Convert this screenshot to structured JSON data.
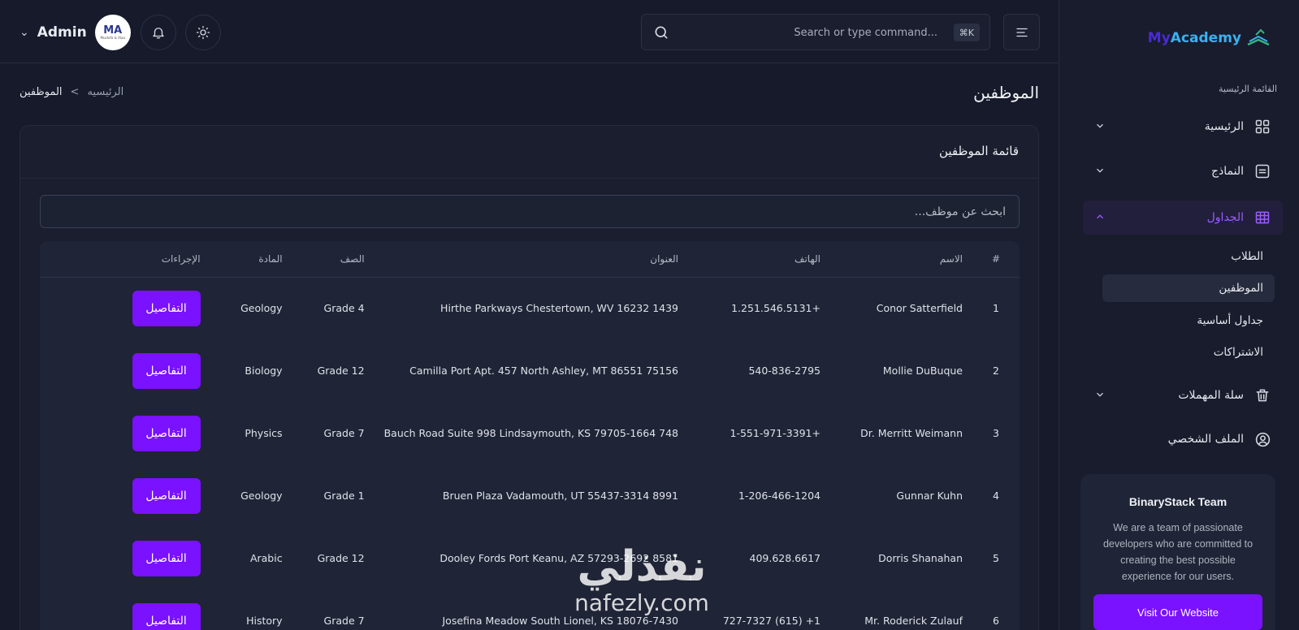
{
  "header": {
    "user_name": "Admin",
    "avatar_initials": "MA",
    "avatar_subtext": "Mustafa & Alaa",
    "search_placeholder": "Search or type command...",
    "search_shortcut": "⌘K"
  },
  "page": {
    "title": "الموظفين",
    "breadcrumb": {
      "current": "الموظفين",
      "separator": "<",
      "home": "الرئيسيه"
    }
  },
  "card": {
    "title": "قائمة الموظفين",
    "search_placeholder": "ابحث عن موظف..."
  },
  "table": {
    "headers": {
      "index": "#",
      "name": "الاسم",
      "phone": "الهاتف",
      "address": "العنوان",
      "grade": "الصف",
      "subject": "المادة",
      "actions": "الإجراءات"
    },
    "details_label": "التفاصيل",
    "rows": [
      {
        "index": "1",
        "name": "Conor Satterfield",
        "phone": "+1.251.546.5131",
        "address": "1439 Hirthe Parkways Chestertown, WV 16232",
        "grade": "Grade 4",
        "subject": "Geology"
      },
      {
        "index": "2",
        "name": "Mollie DuBuque",
        "phone": "540-836-2795",
        "address": "75156 Camilla Port Apt. 457 North Ashley, MT 86551",
        "grade": "Grade 12",
        "subject": "Biology"
      },
      {
        "index": "3",
        "name": "Dr. Merritt Weimann",
        "phone": "+1-551-971-3391",
        "address": "748 Bauch Road Suite 998 Lindsaymouth, KS 79705-1664",
        "grade": "Grade 7",
        "subject": "Physics"
      },
      {
        "index": "4",
        "name": "Gunnar Kuhn",
        "phone": "1-206-466-1204",
        "address": "8991 Bruen Plaza Vadamouth, UT 55437-3314",
        "grade": "Grade 1",
        "subject": "Geology"
      },
      {
        "index": "5",
        "name": "Dorris Shanahan",
        "phone": "409.628.6617",
        "address": "8581 Dooley Fords Port Keanu, AZ 57293-2692",
        "grade": "Grade 12",
        "subject": "Arabic"
      },
      {
        "index": "6",
        "name": "Mr. Roderick Zulauf",
        "phone": "1+ (615) 727-7327",
        "address": "Josefina Meadow South Lionel, KS 18076-7430",
        "grade": "Grade 7",
        "subject": "History"
      }
    ]
  },
  "sidebar": {
    "logo_my": "My",
    "logo_academy": "Academy",
    "section_label": "القائمة الرئيسية",
    "items": [
      {
        "label": "الرئيسية"
      },
      {
        "label": "النماذج"
      },
      {
        "label": "الجداول"
      },
      {
        "label": "سلة المهملات"
      },
      {
        "label": "الملف الشخصي"
      }
    ],
    "sub_items": [
      {
        "label": "الطلاب"
      },
      {
        "label": "الموظفين"
      },
      {
        "label": "جداول أساسية"
      },
      {
        "label": "الاشتراكات"
      }
    ],
    "promo": {
      "title": "BinaryStack Team",
      "text": "We are a team of passionate developers who are committed to creating the best possible experience for our users.",
      "button": "Visit Our Website"
    }
  },
  "watermark": {
    "arabic": "نفذلي",
    "latin": "nafezly.com"
  },
  "colors": {
    "accent": "#7a11ff",
    "active_nav_bg": "#221f3c",
    "background": "#161a2a"
  }
}
